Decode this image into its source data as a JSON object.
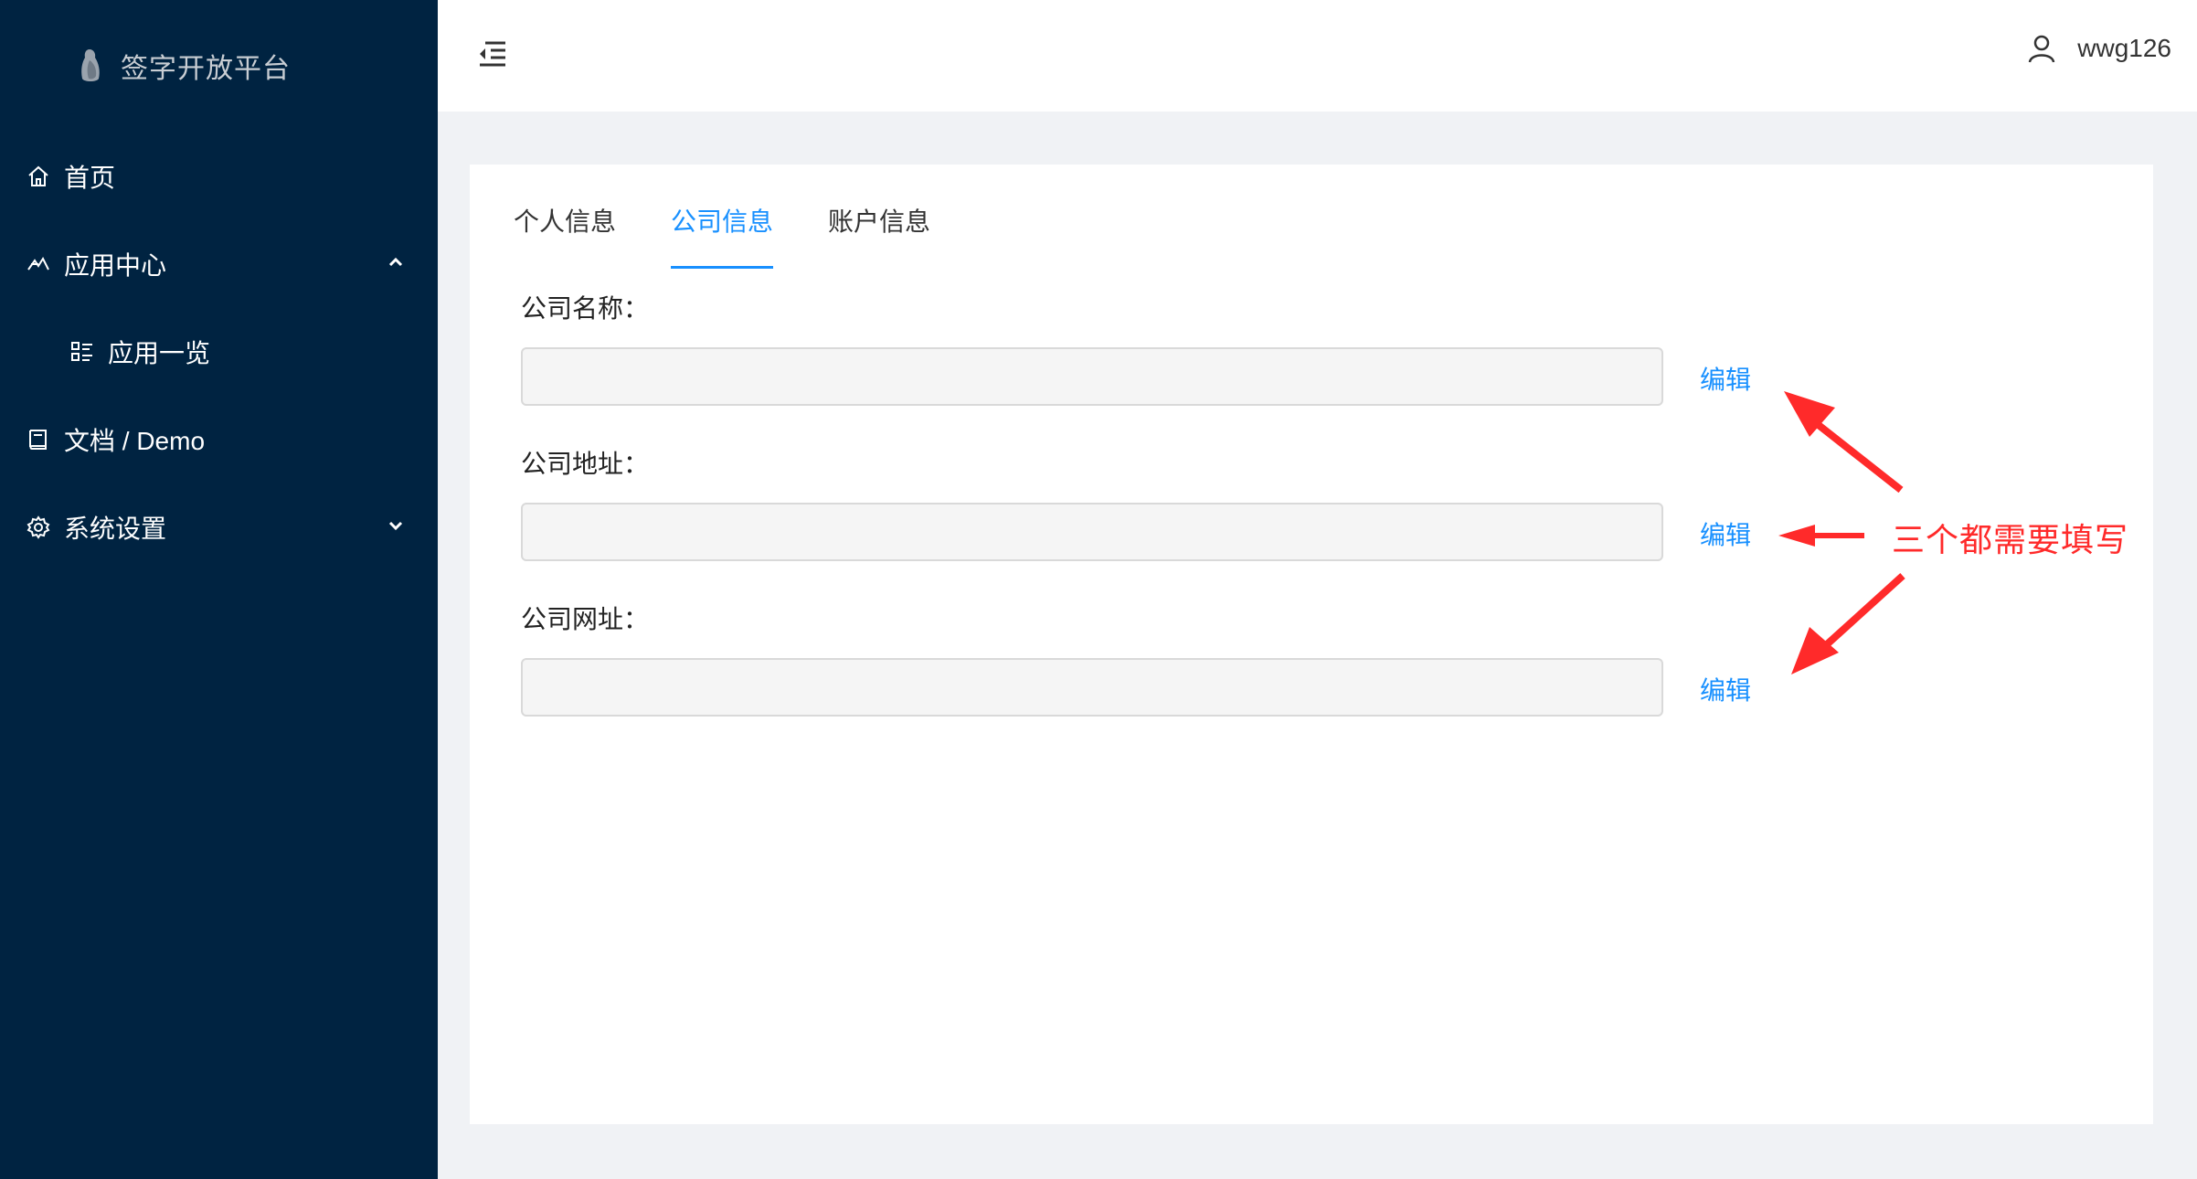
{
  "app": {
    "title": "签字开放平台",
    "brand_color": "#002341",
    "accent_color": "#1890ff"
  },
  "sidebar": {
    "items": [
      {
        "label": "首页",
        "icon": "home-icon"
      },
      {
        "label": "应用中心",
        "icon": "app-center-icon",
        "expanded": true
      },
      {
        "label": "应用一览",
        "icon": "list-icon"
      },
      {
        "label": "文档 / Demo",
        "icon": "book-icon"
      },
      {
        "label": "系统设置",
        "icon": "gear-icon",
        "expanded": false
      }
    ]
  },
  "header": {
    "username": "wwg126"
  },
  "tabs": [
    {
      "label": "个人信息",
      "active": false
    },
    {
      "label": "公司信息",
      "active": true
    },
    {
      "label": "账户信息",
      "active": false
    }
  ],
  "form": {
    "fields": [
      {
        "label": "公司名称：",
        "value": "",
        "action": "编辑"
      },
      {
        "label": "公司地址：",
        "value": "",
        "action": "编辑"
      },
      {
        "label": "公司网址：",
        "value": "",
        "action": "编辑"
      }
    ]
  },
  "annotation": {
    "text": "三个都需要填写",
    "color": "#ff2a2a"
  }
}
